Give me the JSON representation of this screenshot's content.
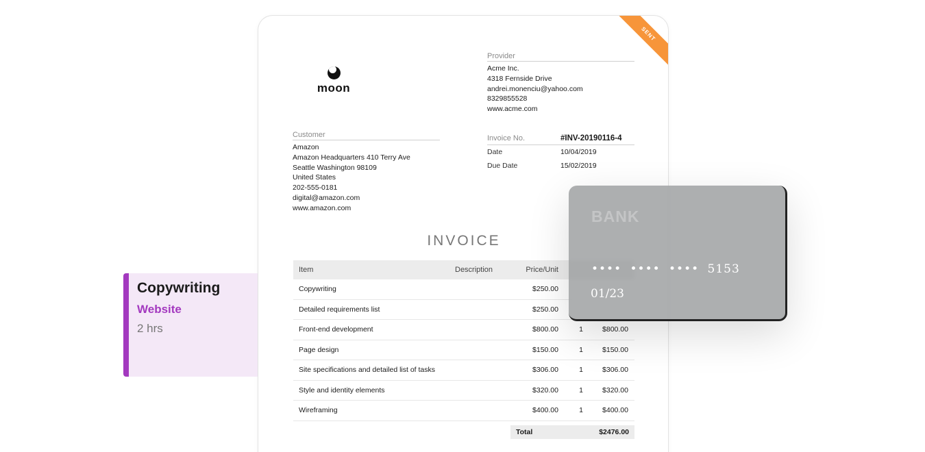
{
  "invoice": {
    "status_ribbon": "SENT",
    "logo_text": "moon",
    "provider": {
      "label": "Provider",
      "lines": [
        "Acme Inc.",
        "4318 Fernside Drive",
        "andrei.monenciu@yahoo.com",
        "8329855528",
        "www.acme.com"
      ]
    },
    "customer": {
      "label": "Customer",
      "lines": [
        "Amazon",
        "Amazon Headquarters 410 Terry Ave",
        "Seattle Washington 98109",
        "United States",
        "202-555-0181",
        "digital@amazon.com",
        "www.amazon.com"
      ]
    },
    "meta": {
      "invoice_no_label": "Invoice No.",
      "invoice_no": "#INV-20190116-4",
      "date_label": "Date",
      "date": "10/04/2019",
      "due_label": "Due Date",
      "due": "15/02/2019"
    },
    "title": "INVOICE",
    "columns": {
      "item": "Item",
      "description": "Description",
      "price": "Price/Unit"
    },
    "rows": [
      {
        "item": "Copywriting",
        "price": "$250.00",
        "qty": "",
        "amount": ""
      },
      {
        "item": "Detailed requirements list",
        "price": "$250.00",
        "qty": "",
        "amount": ""
      },
      {
        "item": "Front-end development",
        "price": "$800.00",
        "qty": "1",
        "amount": "$800.00"
      },
      {
        "item": "Page design",
        "price": "$150.00",
        "qty": "1",
        "amount": "$150.00"
      },
      {
        "item": "Site specifications and detailed list of tasks",
        "price": "$306.00",
        "qty": "1",
        "amount": "$306.00"
      },
      {
        "item": "Style and identity elements",
        "price": "$320.00",
        "qty": "1",
        "amount": "$320.00"
      },
      {
        "item": "Wireframing",
        "price": "$400.00",
        "qty": "1",
        "amount": "$400.00"
      }
    ],
    "total_label": "Total",
    "total": "$2476.00"
  },
  "task_card": {
    "title": "Copywriting",
    "project": "Website",
    "duration": "2 hrs",
    "accent_color": "#a339bf"
  },
  "bank_card": {
    "bank_name": "BANK",
    "number": "•••• •••• •••• 5153",
    "expiry": "01/23"
  }
}
